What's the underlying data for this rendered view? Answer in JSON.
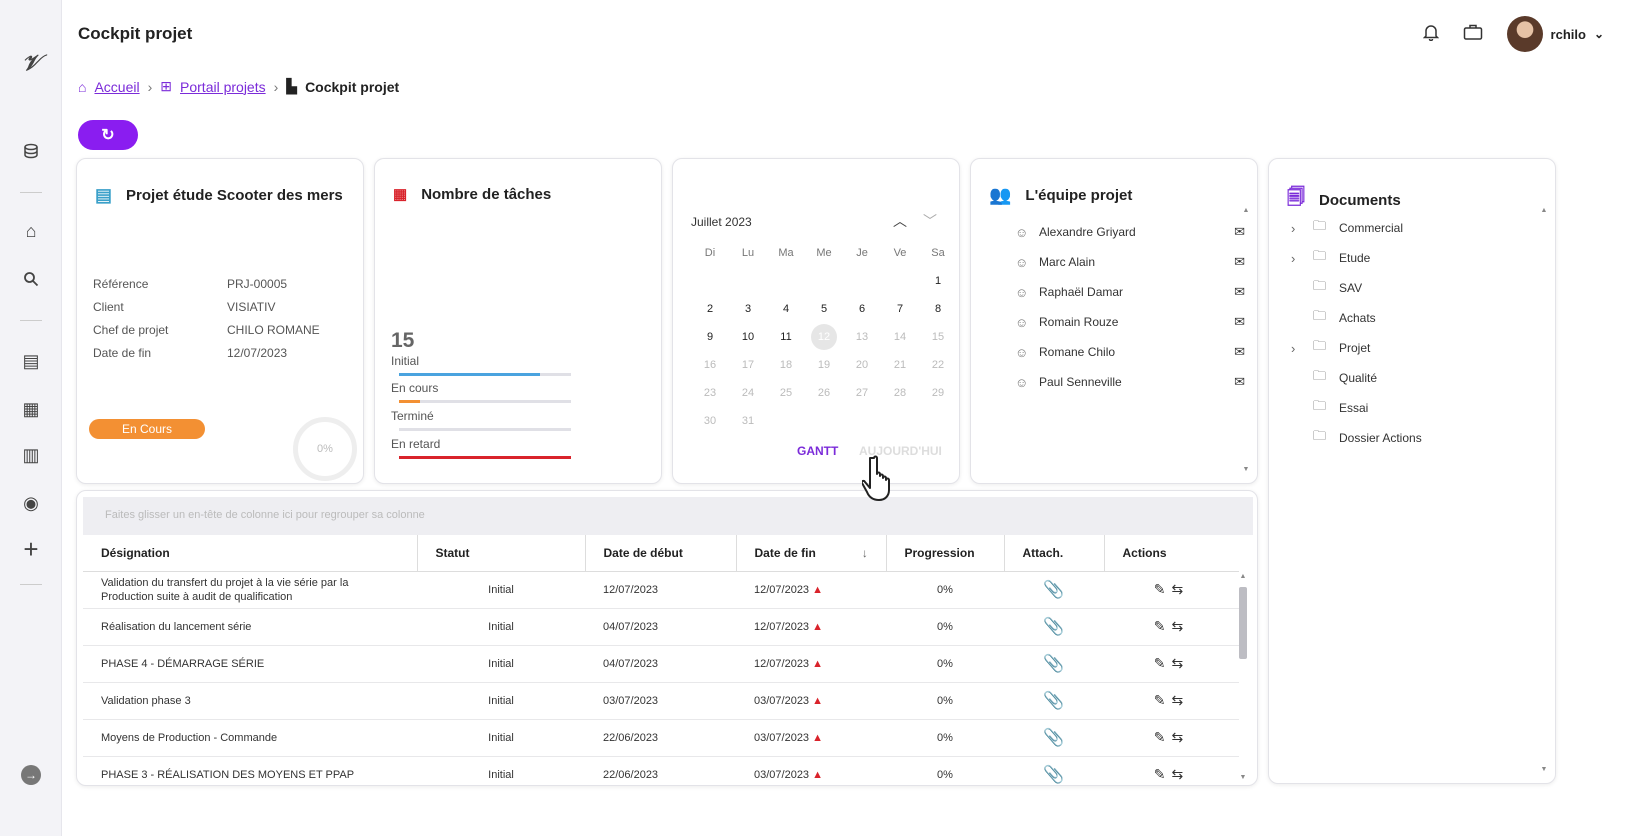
{
  "app": {
    "title": "Cockpit projet",
    "logo": "𝒱"
  },
  "header": {
    "user": "rchilo"
  },
  "breadcrumb": {
    "home": "Accueil",
    "portal": "Portail projets",
    "current": "Cockpit projet"
  },
  "project": {
    "title": "Projet étude Scooter des mers",
    "fields": [
      {
        "k": "Référence",
        "v": "PRJ-00005"
      },
      {
        "k": "Client",
        "v": "VISIATIV"
      },
      {
        "k": "Chef de projet",
        "v": "CHILO ROMANE"
      },
      {
        "k": "Date de fin",
        "v": "12/07/2023"
      }
    ],
    "status": "En Cours",
    "progress_label": "0%",
    "progress": 0
  },
  "tasks": {
    "title": "Nombre de tâches",
    "total": "15",
    "rows": [
      {
        "label": "Initial",
        "color": "#4aa3df",
        "fill": 0.82
      },
      {
        "label": "En cours",
        "color": "#f39033",
        "fill": 0.12
      },
      {
        "label": "Terminé",
        "color": "#c7c7cf",
        "fill": 0.0
      },
      {
        "label": "En retard",
        "color": "#d9232b",
        "fill": 1.0
      }
    ]
  },
  "calendar": {
    "month": "Juillet 2023",
    "dow": [
      "Di",
      "Lu",
      "Ma",
      "Me",
      "Je",
      "Ve",
      "Sa"
    ],
    "selected": "12",
    "gantt": "GANTT",
    "today": "AUJOURD'HUI"
  },
  "team": {
    "title": "L'équipe projet",
    "members": [
      "Alexandre Griyard",
      "Marc Alain",
      "Raphaël Damar",
      "Romain Rouze",
      "Romane Chilo",
      "Paul Senneville"
    ]
  },
  "documents": {
    "title": "Documents",
    "folders": [
      {
        "name": "Commercial",
        "expandable": true
      },
      {
        "name": "Etude",
        "expandable": true
      },
      {
        "name": "SAV",
        "expandable": false
      },
      {
        "name": "Achats",
        "expandable": false
      },
      {
        "name": "Projet",
        "expandable": true
      },
      {
        "name": "Qualité",
        "expandable": false
      },
      {
        "name": "Essai",
        "expandable": false
      },
      {
        "name": "Dossier Actions",
        "expandable": false
      }
    ]
  },
  "grid": {
    "group_hint": "Faites glisser un en-tête de colonne ici pour regrouper sa colonne",
    "columns": [
      "Désignation",
      "Statut",
      "Date de début",
      "Date de fin",
      "Progression",
      "Attach.",
      "Actions"
    ],
    "rows": [
      [
        "Validation du transfert du projet à la vie série par la Production suite à audit de qualification",
        "Initial",
        "12/07/2023",
        "12/07/2023",
        "0%"
      ],
      [
        "Réalisation du lancement série",
        "Initial",
        "04/07/2023",
        "12/07/2023",
        "0%"
      ],
      [
        "PHASE 4 - DÉMARRAGE SÉRIE",
        "Initial",
        "04/07/2023",
        "12/07/2023",
        "0%"
      ],
      [
        "Validation phase 3",
        "Initial",
        "03/07/2023",
        "03/07/2023",
        "0%"
      ],
      [
        "Moyens de Production - Commande",
        "Initial",
        "22/06/2023",
        "03/07/2023",
        "0%"
      ],
      [
        "PHASE 3 - RÉALISATION DES MOYENS ET PPAP",
        "Initial",
        "22/06/2023",
        "03/07/2023",
        "0%"
      ]
    ]
  },
  "colors": {
    "accent": "#8a1df0",
    "link": "#7b2bd9",
    "warning": "#d9232b",
    "status_orange": "#f39033"
  }
}
